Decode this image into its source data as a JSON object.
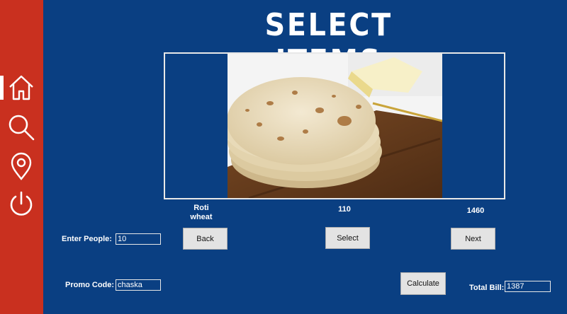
{
  "title": "SELECT ITEMS",
  "sidebar": {
    "items": [
      {
        "icon": "home-icon"
      },
      {
        "icon": "search-icon"
      },
      {
        "icon": "location-pin-icon"
      },
      {
        "icon": "power-icon"
      }
    ]
  },
  "item": {
    "name": "Roti\nwheat",
    "price": "110",
    "count": "1460"
  },
  "form": {
    "people_label": "Enter People:",
    "people_value": "10",
    "promo_label": "Promo Code:",
    "promo_value": "chaska",
    "total_label": "Total Bill:",
    "total_value": "1387"
  },
  "buttons": {
    "back": "Back",
    "select": "Select",
    "next": "Next",
    "calculate": "Calculate"
  },
  "colors": {
    "background": "#0a3f82",
    "sidebar": "#c9301f"
  }
}
